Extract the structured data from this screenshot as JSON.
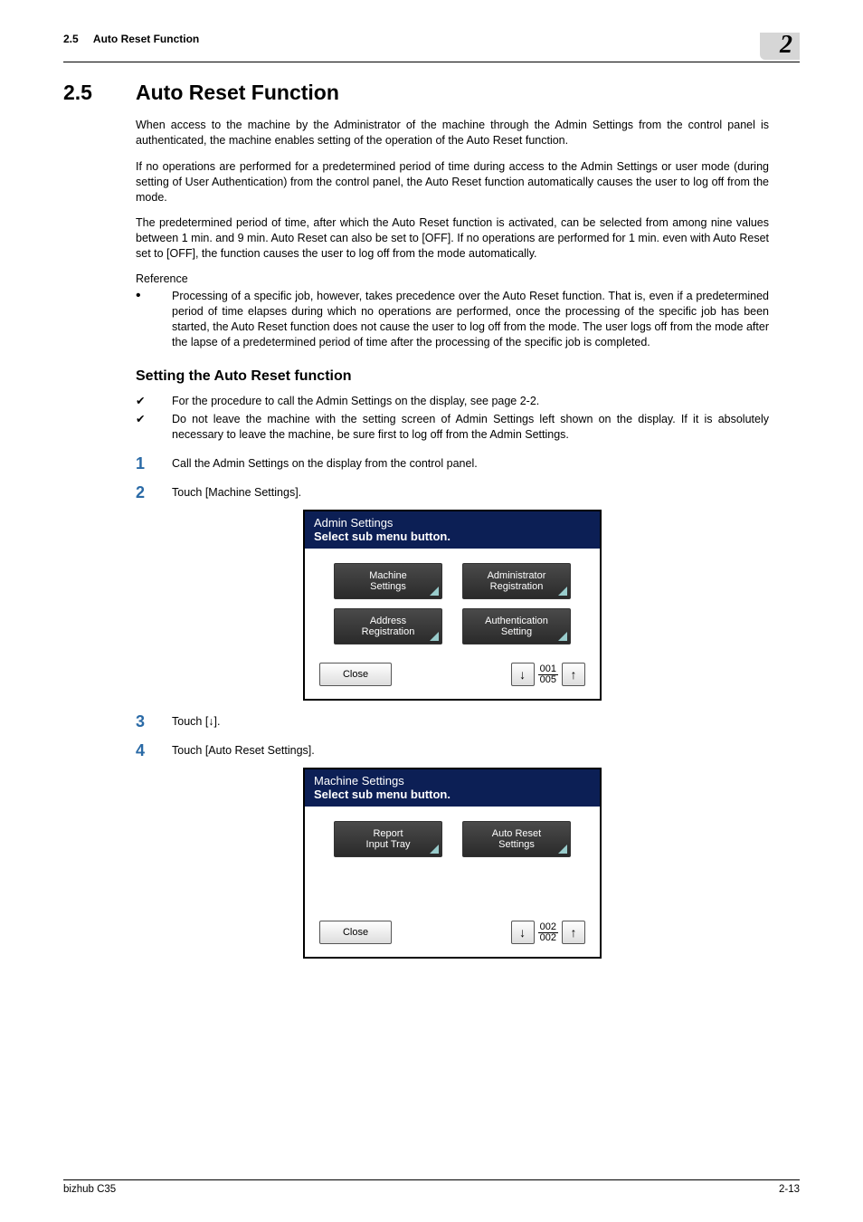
{
  "header": {
    "section_num": "2.5",
    "section_label": "Auto Reset Function",
    "chapter_badge": "2"
  },
  "title": {
    "num": "2.5",
    "text": "Auto Reset Function"
  },
  "paras": {
    "p1": "When access to the machine by the Administrator of the machine through the Admin Settings from the control panel is authenticated, the machine enables setting of the operation of the Auto Reset function.",
    "p2": "If no operations are performed for a predetermined period of time during access to the Admin Settings or user mode (during setting of User Authentication) from the control panel, the Auto Reset function automatically causes the user to log off from the mode.",
    "p3": "The predetermined period of time, after which the Auto Reset function is activated, can be selected from among nine values between 1 min. and 9 min. Auto Reset can also be set to [OFF]. If no operations are performed for 1 min. even with Auto Reset set to [OFF], the function causes the user to log off from the mode automatically.",
    "reference_label": "Reference",
    "ref_bullet": "Processing of a specific job, however, takes precedence over the Auto Reset function. That is, even if a predetermined period of time elapses during which no operations are performed, once the processing of the specific job has been started, the Auto Reset function does not cause the user to log off from the mode. The user logs off from the mode after the lapse of a predetermined period of time after the processing of the specific job is completed."
  },
  "subheading": "Setting the Auto Reset function",
  "checks": {
    "c1": "For the procedure to call the Admin Settings on the display, see page 2-2.",
    "c2": "Do not leave the machine with the setting screen of Admin Settings left shown on the display. If it is absolutely necessary to leave the machine, be sure first to log off from the Admin Settings."
  },
  "steps": {
    "s1": {
      "num": "1",
      "text": "Call the Admin Settings on the display from the control panel."
    },
    "s2": {
      "num": "2",
      "text": "Touch [Machine Settings]."
    },
    "s3": {
      "num": "3",
      "text": "Touch [↓]."
    },
    "s4": {
      "num": "4",
      "text": "Touch [Auto Reset Settings]."
    }
  },
  "screen1": {
    "title1": "Admin Settings",
    "title2": "Select sub menu button.",
    "buttons": {
      "b1a": "Machine",
      "b1b": "Settings",
      "b2a": "Administrator",
      "b2b": "Registration",
      "b3a": "Address",
      "b3b": "Registration",
      "b4a": "Authentication",
      "b4b": "Setting"
    },
    "close": "Close",
    "page_top": "001",
    "page_bot": "005"
  },
  "screen2": {
    "title1": "Machine Settings",
    "title2": "Select sub menu button.",
    "buttons": {
      "b1a": "Report",
      "b1b": "Input Tray",
      "b2a": "Auto Reset",
      "b2b": "Settings"
    },
    "close": "Close",
    "page_top": "002",
    "page_bot": "002"
  },
  "footer": {
    "left": "bizhub C35",
    "right": "2-13"
  }
}
